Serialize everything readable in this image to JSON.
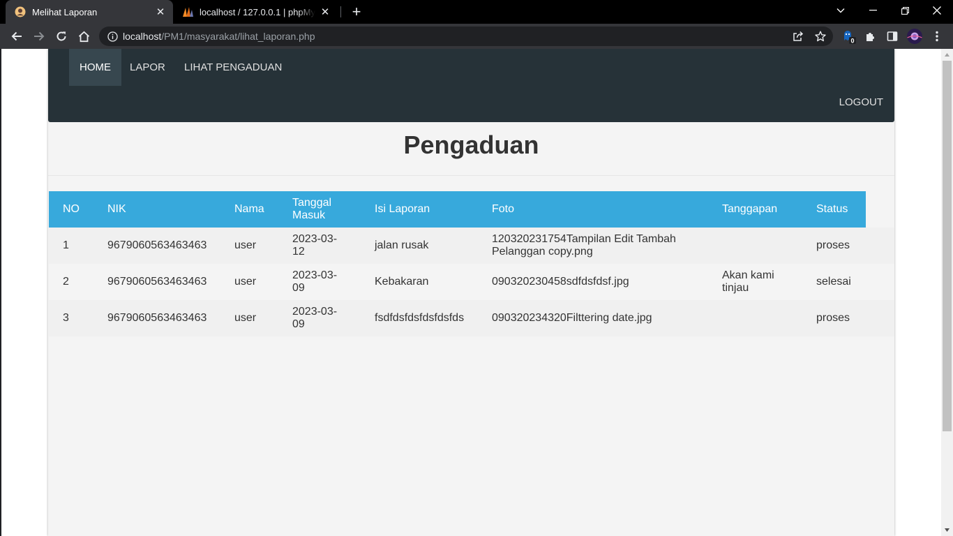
{
  "browser": {
    "tabs": [
      {
        "title": "Melihat Laporan",
        "active": true
      },
      {
        "title": "localhost / 127.0.0.1 | phpMyAdmin",
        "active": false
      }
    ],
    "url_host": "localhost",
    "url_path": "/PM1/masyarakat/lihat_laporan.php",
    "extension_badge": "0"
  },
  "navbar": {
    "items": [
      {
        "label": "HOME",
        "active": true
      },
      {
        "label": "LAPOR",
        "active": false
      },
      {
        "label": "LIHAT PENGADUAN",
        "active": false
      }
    ],
    "logout": "LOGOUT"
  },
  "page": {
    "title": "Pengaduan"
  },
  "table": {
    "headers": {
      "no": "NO",
      "nik": "NIK",
      "nama": "Nama",
      "tanggal_line1": "Tanggal",
      "tanggal_line2": "Masuk",
      "isi": "Isi Laporan",
      "foto": "Foto",
      "tanggapan": "Tanggapan",
      "status": "Status"
    },
    "rows": [
      {
        "no": "1",
        "nik": "9679060563463463",
        "nama": "user",
        "tanggal_line1": "2023-03-",
        "tanggal_line2": "12",
        "isi": "jalan rusak",
        "foto_line1": "120320231754Tampilan Edit Tambah",
        "foto_line2": "Pelanggan copy.png",
        "tanggapan_line1": "",
        "tanggapan_line2": "",
        "status": "proses"
      },
      {
        "no": "2",
        "nik": "9679060563463463",
        "nama": "user",
        "tanggal_line1": "2023-03-",
        "tanggal_line2": "09",
        "isi": "Kebakaran",
        "foto_line1": "090320230458sdfdsfdsf.jpg",
        "foto_line2": "",
        "tanggapan_line1": "Akan kami",
        "tanggapan_line2": "tinjau",
        "status": "selesai"
      },
      {
        "no": "3",
        "nik": "9679060563463463",
        "nama": "user",
        "tanggal_line1": "2023-03-",
        "tanggal_line2": "09",
        "isi": "fsdfdsfdsfdsfdsfds",
        "foto_line1": "090320234320Filttering date.jpg",
        "foto_line2": "",
        "tanggapan_line1": "",
        "tanggapan_line2": "",
        "status": "proses"
      }
    ]
  }
}
